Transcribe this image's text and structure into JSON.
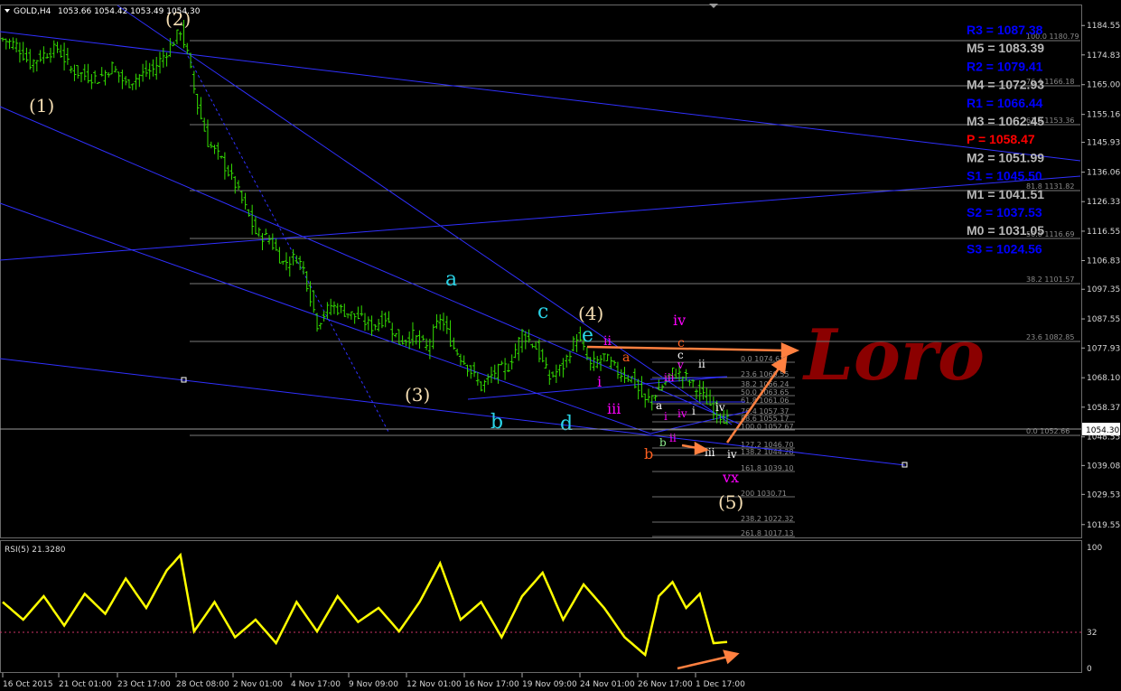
{
  "header": {
    "symbol_label": "GOLD,H4",
    "ohlc": "1053.66 1054.42 1053.49 1054.30",
    "dropdown_icon": "triangle-down-icon"
  },
  "colors": {
    "background": "#000000",
    "candle": "#33dd00",
    "channel": "#3030ff",
    "grid_line": "#7a7a7a",
    "rsi_line": "#ffff00",
    "pivot_res": "#0000ff",
    "pivot_mid": "#b8b8b8",
    "pivot_p": "#ff0000",
    "arrow": "#ff8040",
    "watermark": "#8b0000"
  },
  "watermark": "Loro",
  "price_axis": {
    "ticks": [
      "1184.55",
      "1174.83",
      "1165.00",
      "1155.16",
      "1145.93",
      "1136.06",
      "1126.33",
      "1116.55",
      "1106.83",
      "1097.35",
      "1087.55",
      "1077.93",
      "1068.10",
      "1058.37",
      "1048.55",
      "1039.08",
      "1029.53",
      "1019.55"
    ],
    "current_price": "1054.30"
  },
  "time_axis": [
    "16 Oct 2015",
    "21 Oct 01:00",
    "23 Oct 17:00",
    "28 Oct 08:00",
    "2 Nov 01:00",
    "4 Nov 17:00",
    "9 Nov 09:00",
    "12 Nov 01:00",
    "16 Nov 17:00",
    "19 Nov 09:00",
    "24 Nov 01:00",
    "26 Nov 17:00",
    "1 Dec 17:00"
  ],
  "pivots": [
    {
      "label": "R3 = 1087.38",
      "kind": "res"
    },
    {
      "label": "M5 = 1083.39",
      "kind": "mid"
    },
    {
      "label": "R2 = 1079.41",
      "kind": "res"
    },
    {
      "label": "M4 = 1072.93",
      "kind": "mid"
    },
    {
      "label": "R1 = 1066.44",
      "kind": "res"
    },
    {
      "label": "M3 = 1062.45",
      "kind": "mid"
    },
    {
      "label": "P  = 1058.47",
      "kind": "p"
    },
    {
      "label": "M2 = 1051.99",
      "kind": "mid"
    },
    {
      "label": "S1 = 1045.50",
      "kind": "res"
    },
    {
      "label": "M1 = 1041.51",
      "kind": "mid"
    },
    {
      "label": "S2 = 1037.53",
      "kind": "res"
    },
    {
      "label": "M0 = 1031.05",
      "kind": "mid"
    },
    {
      "label": "S3 = 1024.56",
      "kind": "res"
    }
  ],
  "fib_big": [
    "100.0 1180.79",
    "76.4 1166.18",
    "61.8 1153.36",
    "81.8 1131.82",
    "50.0 1116.69",
    "38.2 1101.57",
    "23.6 1082.85",
    "0.0 1052.66"
  ],
  "fib_small": [
    "0.0 1074.63",
    "23.6 1069.55",
    "38.2 1066.24",
    "50.0 1063.65",
    "61.8 1061.06",
    "76.4 1057.37",
    "88.6 1055.17",
    "100.0 1052.67",
    "127.2 1046.70",
    "138.2 1044.28",
    "161.8 1039.10",
    "200 1030.71",
    "238.2 1022.32",
    "261.8 1017.13"
  ],
  "waves": [
    {
      "t": "(1)",
      "c": "#f5deb3",
      "s": 20
    },
    {
      "t": "(2)",
      "c": "#f5deb3",
      "s": 20
    },
    {
      "t": "(3)",
      "c": "#f5deb3",
      "s": 20
    },
    {
      "t": "(4)",
      "c": "#f5deb3",
      "s": 20
    },
    {
      "t": "(5)",
      "c": "#f5deb3",
      "s": 20
    },
    {
      "t": "a",
      "c": "#2ad4e8",
      "s": 22
    },
    {
      "t": "b",
      "c": "#2ad4e8",
      "s": 22
    },
    {
      "t": "c",
      "c": "#2ad4e8",
      "s": 22
    },
    {
      "t": "d",
      "c": "#2ad4e8",
      "s": 22
    },
    {
      "t": "e",
      "c": "#2ad4e8",
      "s": 22
    },
    {
      "t": "ii",
      "c": "#ff00ff",
      "s": 14
    },
    {
      "t": "i",
      "c": "#ff00ff",
      "s": 16
    },
    {
      "t": "iii",
      "c": "#ff00ff",
      "s": 16
    },
    {
      "t": "iv",
      "c": "#ff00ff",
      "s": 16
    },
    {
      "t": "a",
      "c": "#ff6020",
      "s": 14
    },
    {
      "t": "c",
      "c": "#ff6020",
      "s": 14
    },
    {
      "t": "b",
      "c": "#ff6020",
      "s": 16
    },
    {
      "t": "v",
      "c": "#ff00ff",
      "s": 12
    },
    {
      "t": "c",
      "c": "#ffffff",
      "s": 12
    },
    {
      "t": "ii",
      "c": "#ffffff",
      "s": 12
    },
    {
      "t": "iii",
      "c": "#ff00ff",
      "s": 12
    },
    {
      "t": "i",
      "c": "#ffffff",
      "s": 12
    },
    {
      "t": "iv",
      "c": "#ff00ff",
      "s": 12
    },
    {
      "t": "iv",
      "c": "#ffffff",
      "s": 12
    },
    {
      "t": "a",
      "c": "#ffffff",
      "s": 12
    },
    {
      "t": "i",
      "c": "#ff00ff",
      "s": 12
    },
    {
      "t": "ii",
      "c": "#ff00ff",
      "s": 12
    },
    {
      "t": "b",
      "c": "#90ee90",
      "s": 12
    },
    {
      "t": "iii",
      "c": "#ffffff",
      "s": 12
    },
    {
      "t": "iv",
      "c": "#ffffff",
      "s": 12
    },
    {
      "t": "vx",
      "c": "#ff00ff",
      "s": 16
    }
  ],
  "rsi_panel": {
    "label": "RSI(5) 21.3280",
    "ticks": [
      "100",
      "32",
      "0"
    ]
  },
  "chart_data": {
    "type": "candlestick",
    "symbol": "GOLD",
    "timeframe": "H4",
    "last": {
      "open": 1053.66,
      "high": 1054.42,
      "low": 1053.49,
      "close": 1054.3
    },
    "y_range": [
      1015,
      1190
    ],
    "close_path": [
      [
        0,
        1180
      ],
      [
        4,
        1178
      ],
      [
        8,
        1172
      ],
      [
        12,
        1175
      ],
      [
        16,
        1177
      ],
      [
        20,
        1170
      ],
      [
        24,
        1168
      ],
      [
        28,
        1167
      ],
      [
        32,
        1171
      ],
      [
        36,
        1165
      ],
      [
        40,
        1168
      ],
      [
        44,
        1170
      ],
      [
        48,
        1176
      ],
      [
        52,
        1183
      ],
      [
        54,
        1175
      ],
      [
        57,
        1158
      ],
      [
        60,
        1146
      ],
      [
        64,
        1140
      ],
      [
        68,
        1132
      ],
      [
        71,
        1124
      ],
      [
        74,
        1116
      ],
      [
        78,
        1114
      ],
      [
        82,
        1106
      ],
      [
        86,
        1108
      ],
      [
        88,
        1104
      ],
      [
        92,
        1086
      ],
      [
        96,
        1092
      ],
      [
        100,
        1090
      ],
      [
        104,
        1088
      ],
      [
        108,
        1085
      ],
      [
        112,
        1088
      ],
      [
        116,
        1080
      ],
      [
        120,
        1082
      ],
      [
        124,
        1078
      ],
      [
        128,
        1088
      ],
      [
        132,
        1078
      ],
      [
        136,
        1072
      ],
      [
        140,
        1065
      ],
      [
        144,
        1070
      ],
      [
        148,
        1072
      ],
      [
        152,
        1083
      ],
      [
        156,
        1078
      ],
      [
        160,
        1068
      ],
      [
        164,
        1072
      ],
      [
        168,
        1082
      ],
      [
        172,
        1072
      ],
      [
        176,
        1075
      ],
      [
        180,
        1070
      ],
      [
        184,
        1068
      ],
      [
        188,
        1060
      ],
      [
        192,
        1064
      ],
      [
        196,
        1070
      ],
      [
        200,
        1068
      ],
      [
        204,
        1063
      ],
      [
        208,
        1058
      ],
      [
        212,
        1054
      ]
    ],
    "rsi_path": [
      [
        0,
        55
      ],
      [
        6,
        40
      ],
      [
        12,
        60
      ],
      [
        18,
        35
      ],
      [
        24,
        62
      ],
      [
        30,
        45
      ],
      [
        36,
        75
      ],
      [
        42,
        50
      ],
      [
        48,
        82
      ],
      [
        52,
        95
      ],
      [
        56,
        30
      ],
      [
        62,
        55
      ],
      [
        68,
        25
      ],
      [
        74,
        40
      ],
      [
        80,
        20
      ],
      [
        86,
        55
      ],
      [
        92,
        30
      ],
      [
        98,
        60
      ],
      [
        104,
        38
      ],
      [
        110,
        50
      ],
      [
        116,
        30
      ],
      [
        122,
        55
      ],
      [
        128,
        88
      ],
      [
        134,
        40
      ],
      [
        140,
        55
      ],
      [
        146,
        25
      ],
      [
        152,
        60
      ],
      [
        158,
        80
      ],
      [
        164,
        40
      ],
      [
        170,
        70
      ],
      [
        176,
        50
      ],
      [
        182,
        25
      ],
      [
        188,
        10
      ],
      [
        192,
        60
      ],
      [
        196,
        72
      ],
      [
        200,
        50
      ],
      [
        204,
        62
      ],
      [
        208,
        20
      ],
      [
        212,
        21
      ]
    ]
  }
}
